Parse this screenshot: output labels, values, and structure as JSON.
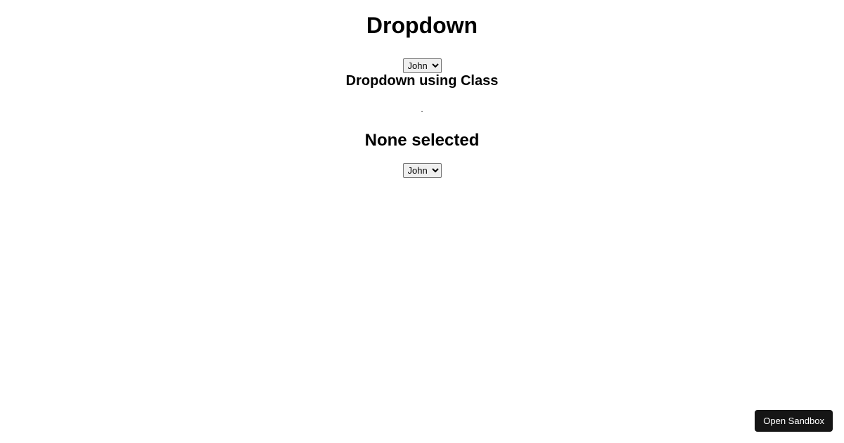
{
  "headings": {
    "main": "Dropdown",
    "class": "Dropdown using Class",
    "none": "None selected"
  },
  "dropdown1": {
    "selected": "John",
    "options": [
      "John"
    ]
  },
  "dropdown2": {
    "selected": "John",
    "options": [
      "John"
    ]
  },
  "separator": ".",
  "sandbox_button": "Open Sandbox"
}
